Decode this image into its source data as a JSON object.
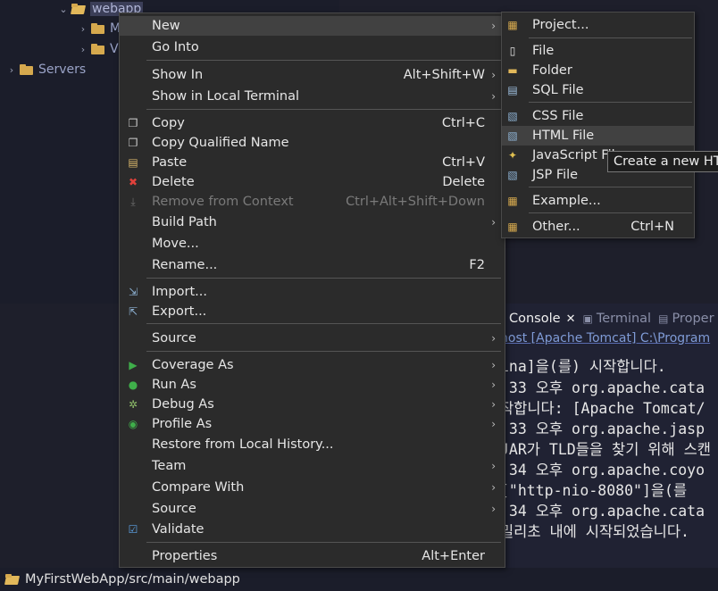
{
  "tree": {
    "selected_folder": "webapp",
    "child1_initial": "M",
    "child2_initial": "V",
    "servers": "Servers"
  },
  "console": {
    "tabs": [
      "Console",
      "Terminal",
      "Proper"
    ],
    "header_line": "nost [Apache Tomcat] C:\\Program",
    "lines": [
      "ina]을(를) 시작합니다.",
      ":33 오후 org.apache.cata",
      "작합니다: [Apache Tomcat/",
      ":33 오후 org.apache.jasp",
      "JAR가 TLD들을 찾기 위해 스캔",
      ":34 오후 org.apache.coyo",
      " [\"http-nio-8080\"]을(를",
      ":34 오후 org.apache.cata",
      " 밀리초 내에 시작되었습니다."
    ]
  },
  "status_bar": {
    "path": "MyFirstWebApp/src/main/webapp"
  },
  "context_menu": {
    "new": "New",
    "go_into": "Go Into",
    "show_in": "Show In",
    "show_in_shortcut": "Alt+Shift+W",
    "show_in_local_terminal": "Show in Local Terminal",
    "copy": "Copy",
    "copy_shortcut": "Ctrl+C",
    "copy_qualified_name": "Copy Qualified Name",
    "paste": "Paste",
    "paste_shortcut": "Ctrl+V",
    "delete": "Delete",
    "delete_shortcut": "Delete",
    "remove_from_context": "Remove from Context",
    "remove_from_context_shortcut": "Ctrl+Alt+Shift+Down",
    "build_path": "Build Path",
    "move": "Move...",
    "rename": "Rename...",
    "rename_shortcut": "F2",
    "import": "Import...",
    "export": "Export...",
    "source1": "Source",
    "coverage_as": "Coverage As",
    "run_as": "Run As",
    "debug_as": "Debug As",
    "profile_as": "Profile As",
    "restore_history": "Restore from Local History...",
    "team": "Team",
    "compare_with": "Compare With",
    "source2": "Source",
    "validate": "Validate",
    "properties": "Properties",
    "properties_shortcut": "Alt+Enter"
  },
  "new_submenu": {
    "project": "Project...",
    "file": "File",
    "folder": "Folder",
    "sql_file": "SQL File",
    "css_file": "CSS File",
    "html_file": "HTML File",
    "javascript_file": "JavaScript File",
    "jsp_file": "JSP File",
    "example": "Example...",
    "other": "Other...",
    "other_shortcut": "Ctrl+N"
  },
  "tooltip": "Create a new HTML",
  "colors": {
    "menu_bg": "#2b2b2b",
    "menu_highlight": "#414141",
    "editor_bg": "#1e1f2b",
    "disabled_text": "#7a7a7a"
  }
}
